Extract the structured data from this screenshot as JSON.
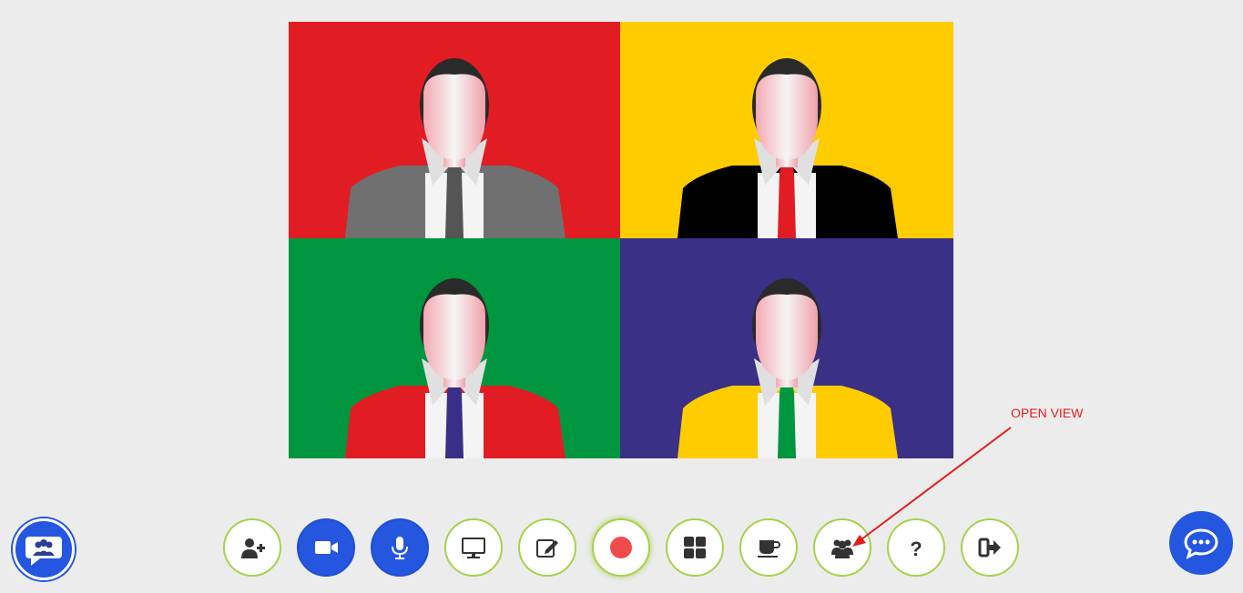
{
  "participants": [
    {
      "name": "participant-1",
      "background": "#e11d23",
      "jacket": "#707070",
      "tie": "#555555"
    },
    {
      "name": "participant-2",
      "background": "#ffcc00",
      "jacket": "#000000",
      "tie": "#e11d23"
    },
    {
      "name": "participant-3",
      "background": "#009640",
      "jacket": "#e11d23",
      "tie": "#3a2f86"
    },
    {
      "name": "participant-4",
      "background": "#3a3086",
      "jacket": "#ffcc00",
      "tie": "#009640"
    }
  ],
  "toolbar": {
    "buttons": [
      {
        "icon": "add-user-icon",
        "style": "light"
      },
      {
        "icon": "video-camera-icon",
        "style": "blue"
      },
      {
        "icon": "microphone-icon",
        "style": "blue"
      },
      {
        "icon": "screen-share-icon",
        "style": "light"
      },
      {
        "icon": "whiteboard-edit-icon",
        "style": "light"
      },
      {
        "icon": "record-icon",
        "style": "light"
      },
      {
        "icon": "grid-view-icon",
        "style": "light"
      },
      {
        "icon": "coffee-break-icon",
        "style": "light"
      },
      {
        "icon": "participants-icon",
        "style": "light"
      },
      {
        "icon": "help-icon",
        "style": "light"
      },
      {
        "icon": "leave-icon",
        "style": "light"
      }
    ]
  },
  "annotation": {
    "label": "OPEN VIEW",
    "color": "#e41d1d"
  },
  "colors": {
    "accent_blue": "#2456e0",
    "button_border": "#a6d14a",
    "record_red": "#f04b4b"
  }
}
